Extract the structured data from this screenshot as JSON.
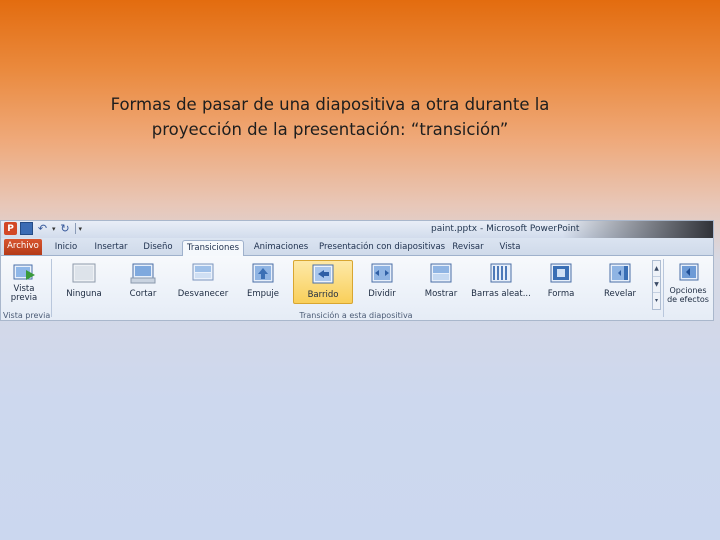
{
  "slide": {
    "title_line1": "Formas de pasar de una diapositiva a otra durante la",
    "title_line2": "proyección de la presentación: “transición”"
  },
  "window": {
    "title": "paint.pptx - Microsoft PowerPoint"
  },
  "tabs": [
    {
      "label": "Archivo"
    },
    {
      "label": "Inicio"
    },
    {
      "label": "Insertar"
    },
    {
      "label": "Diseño"
    },
    {
      "label": "Transiciones"
    },
    {
      "label": "Animaciones"
    },
    {
      "label": "Presentación con diapositivas"
    },
    {
      "label": "Revisar"
    },
    {
      "label": "Vista"
    }
  ],
  "ribbon": {
    "preview": {
      "line1": "Vista",
      "line2": "previa",
      "group_label": "Vista previa"
    },
    "transitions": [
      {
        "label": "Ninguna",
        "icon": "none-transition-icon"
      },
      {
        "label": "Cortar",
        "icon": "cut-transition-icon"
      },
      {
        "label": "Desvanecer",
        "icon": "fade-transition-icon"
      },
      {
        "label": "Empuje",
        "icon": "push-transition-icon"
      },
      {
        "label": "Barrido",
        "icon": "wipe-transition-icon"
      },
      {
        "label": "Dividir",
        "icon": "split-transition-icon"
      },
      {
        "label": "Mostrar",
        "icon": "reveal-transition-icon"
      },
      {
        "label": "Barras aleat...",
        "icon": "random-bars-transition-icon"
      },
      {
        "label": "Forma",
        "icon": "shape-transition-icon"
      },
      {
        "label": "Revelar",
        "icon": "uncover-transition-icon"
      }
    ],
    "transitions_group_label": "Transición a esta diapositiva",
    "effect_options": {
      "line1": "Opciones",
      "line2": "de efectos"
    }
  },
  "colors": {
    "file_tab": "#c8452a",
    "selected_command": "#f9cf5a",
    "accent_blue": "#3b6cb4"
  }
}
